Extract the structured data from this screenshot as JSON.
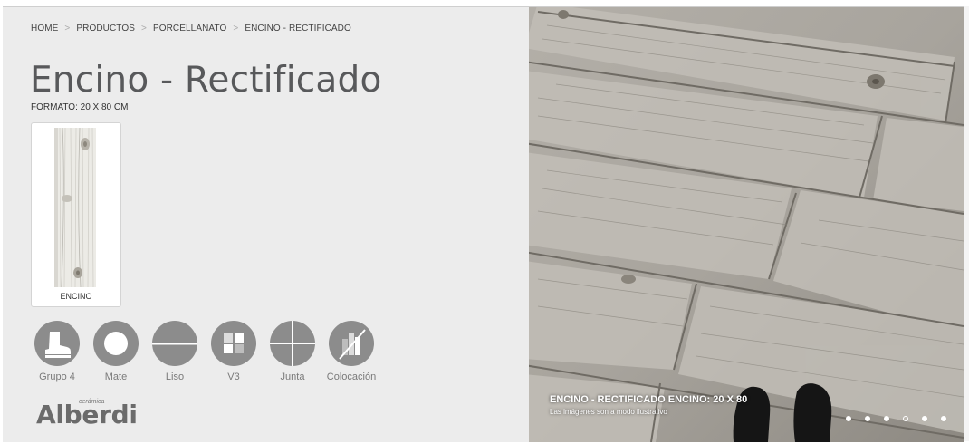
{
  "breadcrumb": {
    "items": [
      "HOME",
      "PRODUCTOS",
      "PORCELLANATO",
      "ENCINO - RECTIFICADO"
    ],
    "separator": ">"
  },
  "product": {
    "title": "Encino - Rectificado",
    "format": "FORMATO: 20 X 80 CM",
    "variant_label": "ENCINO"
  },
  "properties": [
    {
      "icon": "boot-icon",
      "label": "Grupo 4"
    },
    {
      "icon": "matte-finish-icon",
      "label": "Mate"
    },
    {
      "icon": "smooth-surface-icon",
      "label": "Liso"
    },
    {
      "icon": "tone-variation-icon",
      "label": "V3"
    },
    {
      "icon": "joint-icon",
      "label": "Junta"
    },
    {
      "icon": "installation-icon",
      "label": "Colocación"
    }
  ],
  "logo": {
    "small": "cerámica",
    "big": "Alberdi"
  },
  "slideshow": {
    "caption_title": "ENCINO - RECTIFICADO ENCINO: 20 X 80",
    "caption_note": "Las imágenes son a modo ilustrativo",
    "slide_count": 6,
    "active_slides": [
      1,
      2,
      3,
      5,
      6
    ]
  },
  "colors": {
    "panel_bg": "#ececec",
    "icon_gray": "#8c8c8c",
    "title_gray": "#58595b"
  }
}
